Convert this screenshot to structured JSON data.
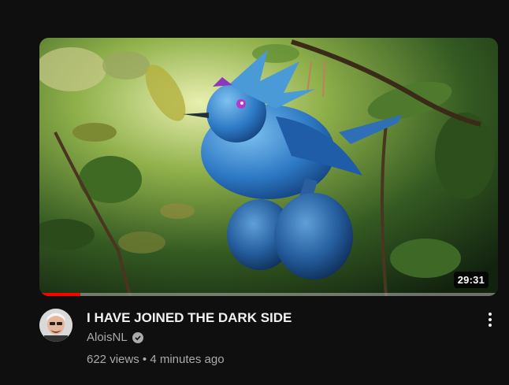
{
  "video": {
    "title": "I HAVE JOINED THE DARK SIDE",
    "duration": "29:31",
    "progress_fraction": 0.09,
    "channel": "AloisNL",
    "views": "622 views",
    "separator": "•",
    "published": "4 minutes ago"
  },
  "colors": {
    "background": "#0f0f0f",
    "progress": "#ff0000",
    "secondary_text": "#aaaaaa"
  },
  "icons": {
    "verified": "verified-check-icon",
    "more": "more-vert-icon"
  }
}
